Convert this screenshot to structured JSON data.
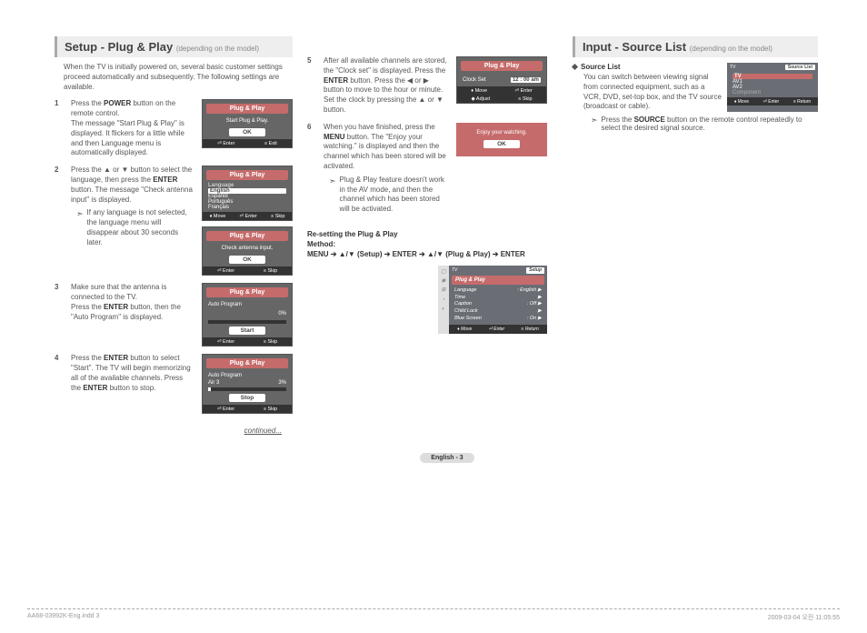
{
  "header_setup": {
    "title": "Setup - Plug & Play",
    "subtitle": "(depending on the model)"
  },
  "header_input": {
    "title": "Input - Source List",
    "subtitle": "(depending on the model)"
  },
  "intro": "When the TV is initially powered on, several basic customer settings proceed automatically and subsequently. The following settings are available.",
  "steps": {
    "s1_num": "1",
    "s1_text": "Press the POWER button on the remote control.\nThe message \"Start Plug & Play\" is displayed. It flickers for a little while and then Language menu is automatically displayed.",
    "s2_num": "2",
    "s2_text": "Press the ▲ or ▼ button to select the language, then press the ENTER button. The message \"Check antenna input\" is displayed.",
    "s2_sub": "If any language is not selected, the language menu will disappear about 30 seconds later.",
    "s3_num": "3",
    "s3_text": "Make sure that the antenna is connected to the TV.\nPress the ENTER button, then the \"Auto Program\" is displayed.",
    "s4_num": "4",
    "s4_text": "Press the ENTER button to select \"Start\". The TV will begin memorizing all of the available channels. Press the ENTER button to stop.",
    "s5_num": "5",
    "s5_text": "After all available channels are stored, the \"Clock set\" is displayed. Press the ENTER button. Press the ◀ or ▶ button to move to the hour or minute. Set the clock by pressing the ▲ or ▼ button.",
    "s6_num": "6",
    "s6_text": "When you have finished, press the MENU button. The \"Enjoy your watching.\" is displayed and then the channel which has been stored will be activated.",
    "s6_sub": "Plug & Play feature doesn't work in the AV mode, and then the channel which has been stored will be activated."
  },
  "osd": {
    "pp": "Plug & Play",
    "start_pp": "Start Plug & Play.",
    "ok": "OK",
    "enter": "Enter",
    "exit": "Exit",
    "move": "Move",
    "skip": "Skip",
    "language": "Language",
    "lang_english": "English",
    "lang_espanol": "Español",
    "lang_portugues": "Português",
    "lang_francais": "Français",
    "check_antenna": "Check antenna input.",
    "auto_program": "Auto Program",
    "pct0": "0%",
    "start": "Start",
    "air3": "Air 3",
    "pct3": "3%",
    "stop": "Stop",
    "clock_set": "Clock Set",
    "clock_time": "12 : 00 am",
    "adjust": "Adjust",
    "enjoy": "Enjoy your watching.",
    "tv": "TV",
    "setup": "Setup",
    "src_list": "Source List",
    "src_tv": "TV",
    "src_av1": "AV1",
    "src_av2": "AV2",
    "src_comp": "Component",
    "return": "Return",
    "setup_lang": "Language",
    "setup_lang_v": ": English",
    "setup_time": "Time",
    "setup_caption": "Caption",
    "setup_caption_v": ": Off",
    "setup_childlock": "Child Lock",
    "setup_blue": "Blue Screen",
    "setup_blue_v": ": On"
  },
  "reset": {
    "title": "Re-setting the Plug & Play",
    "method": "Method:",
    "path": "MENU ➔ ▲/▼ (Setup) ➔ ENTER ➔ ▲/▼ (Plug & Play) ➔ ENTER"
  },
  "continued": "continued...",
  "input": {
    "heading": "Source List",
    "text": "You can switch between viewing signal from connected equipment, such as a VCR, DVD, set-top box, and the TV source (broadcast or cable).",
    "sub": "Press the SOURCE button on the remote control repeatedly to select the desired signal source."
  },
  "page_num": "English - 3",
  "footer": {
    "left": "AA68-03992K-Eng.indd   3",
    "right": "2009-03-04   오전 11:05:55"
  }
}
